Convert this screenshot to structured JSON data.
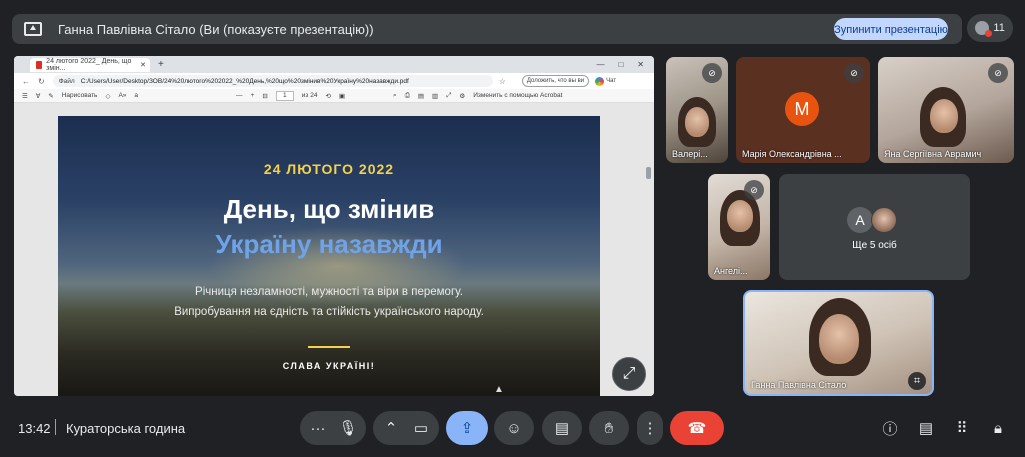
{
  "topbar": {
    "presenter_title": "Ганна Павлівна Сітало (Ви (показуєте презентацію))",
    "stop_label": "Зупинити презентацію",
    "people_count": "11"
  },
  "browser": {
    "tab_title": "24 лютого 2022_ День, що змін...",
    "file_label": "Файл",
    "url": "C:/Users/User/Desktop/ЗОВ/24%20лютого%202022_%20День,%20що%20змінив%20Україну%20назавжди.pdf",
    "ask_placeholder": "Доложить, что вы ви",
    "chat_label": "Чат",
    "draw_label": "Нарисовать",
    "page_current": "1",
    "page_total": "из 24",
    "acrobat_label": "Изменить с помощью Acrobat"
  },
  "slide": {
    "date": "24 ЛЮТОГО 2022",
    "title_line1": "День, що змінив",
    "title_line2": "Україну назавжди",
    "subtitle_line1": "Річниця незламності, мужності та віри в перемогу.",
    "subtitle_line2": "Випробування на єдність та стійкість українського народу.",
    "footer": "СЛАВА УКРАЇНІ!"
  },
  "participants": [
    {
      "name": "Валері...",
      "muted": true
    },
    {
      "name": "Марія Олександрівна ...",
      "initial": "M",
      "muted": true
    },
    {
      "name": "Яна Сергіївна Аврамич",
      "muted": true
    },
    {
      "name": "Ангелі...",
      "muted": true
    }
  ],
  "more_tile": {
    "initial": "A",
    "label": "Ще 5 осіб"
  },
  "self_tile": {
    "name": "Ганна Павлівна Сітало"
  },
  "bottombar": {
    "time": "13:42",
    "meeting_name": "Кураторська година"
  },
  "colors": {
    "accent": "#8ab4f8",
    "hangup": "#ea4335",
    "slide_date": "#f5d24a",
    "slide_title_accent": "#6fa3e8"
  },
  "icons": {
    "present": "present-icon",
    "mic_off": "mic-off-icon",
    "expand": "expand-icon",
    "crop": "crop-icon",
    "more": "more-vert-icon",
    "mic": "mic-icon",
    "camera": "camera-icon",
    "present_now": "present-now-icon",
    "emoji": "emoji-icon",
    "captions": "captions-icon",
    "hand": "raise-hand-icon",
    "hangup": "hangup-icon",
    "info": "info-icon",
    "chat": "chat-icon",
    "activities": "apps-icon",
    "host": "host-controls-icon"
  }
}
